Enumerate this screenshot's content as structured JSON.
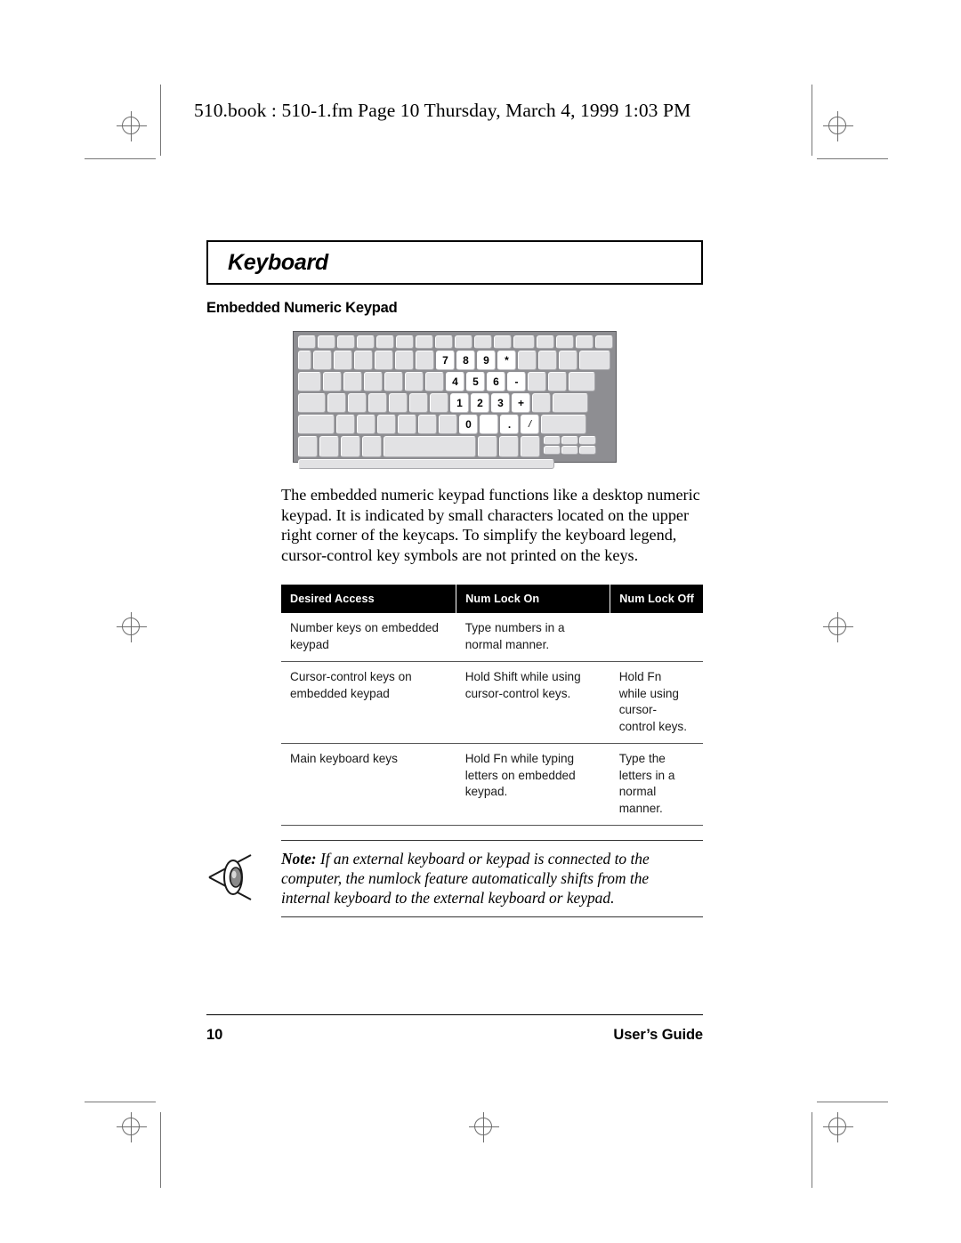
{
  "print_header": "510.book : 510-1.fm  Page 10  Thursday, March 4, 1999  1:03 PM",
  "page": {
    "title": "Keyboard",
    "subhead": "Embedded Numeric Keypad",
    "body_paragraph": "The embedded numeric keypad functions like a desktop numeric keypad.  It is indicated by small characters located on the upper right corner of the keycaps.  To simplify the keyboard legend, cursor-control key symbols are not printed on the keys."
  },
  "keyboard_figure": {
    "caption": "",
    "highlighted_keys": {
      "row1": [
        "7",
        "8",
        "9",
        "*"
      ],
      "row2": [
        "4",
        "5",
        "6",
        "-"
      ],
      "row3": [
        "1",
        "2",
        "3",
        "+"
      ],
      "row4": [
        "0",
        "",
        ".",
        "/"
      ]
    }
  },
  "table": {
    "headers": [
      "Desired Access",
      "Num Lock On",
      "Num Lock Off"
    ],
    "rows": [
      {
        "access": "Number keys on embedded keypad",
        "numlock_on": "Type numbers in a normal manner.",
        "numlock_off": ""
      },
      {
        "access": "Cursor-control keys on embedded keypad",
        "numlock_on": "Hold Shift while using cursor-control keys.",
        "numlock_off": "Hold Fn while using cursor-control keys."
      },
      {
        "access": "Main keyboard keys",
        "numlock_on": "Hold Fn while typing letters on embedded keypad.",
        "numlock_off": "Type the letters in a normal manner."
      }
    ]
  },
  "note": {
    "label": "Note:",
    "text": " If an external keyboard or keypad is connected to the computer, the numlock feature automatically shifts from the internal keyboard to the external keyboard or keypad.",
    "icon": "eye-note-icon"
  },
  "footer": {
    "page_number": "10",
    "guide_label": "User’s Guide"
  },
  "colors": {
    "table_header_bg": "#000000",
    "table_header_fg": "#ffffff",
    "rule": "#555555",
    "keyboard_body": "#8e8e92",
    "key_face": "#e2e2e4",
    "key_lit": "#ffffff",
    "reg_mark": "#6d6d6d"
  }
}
